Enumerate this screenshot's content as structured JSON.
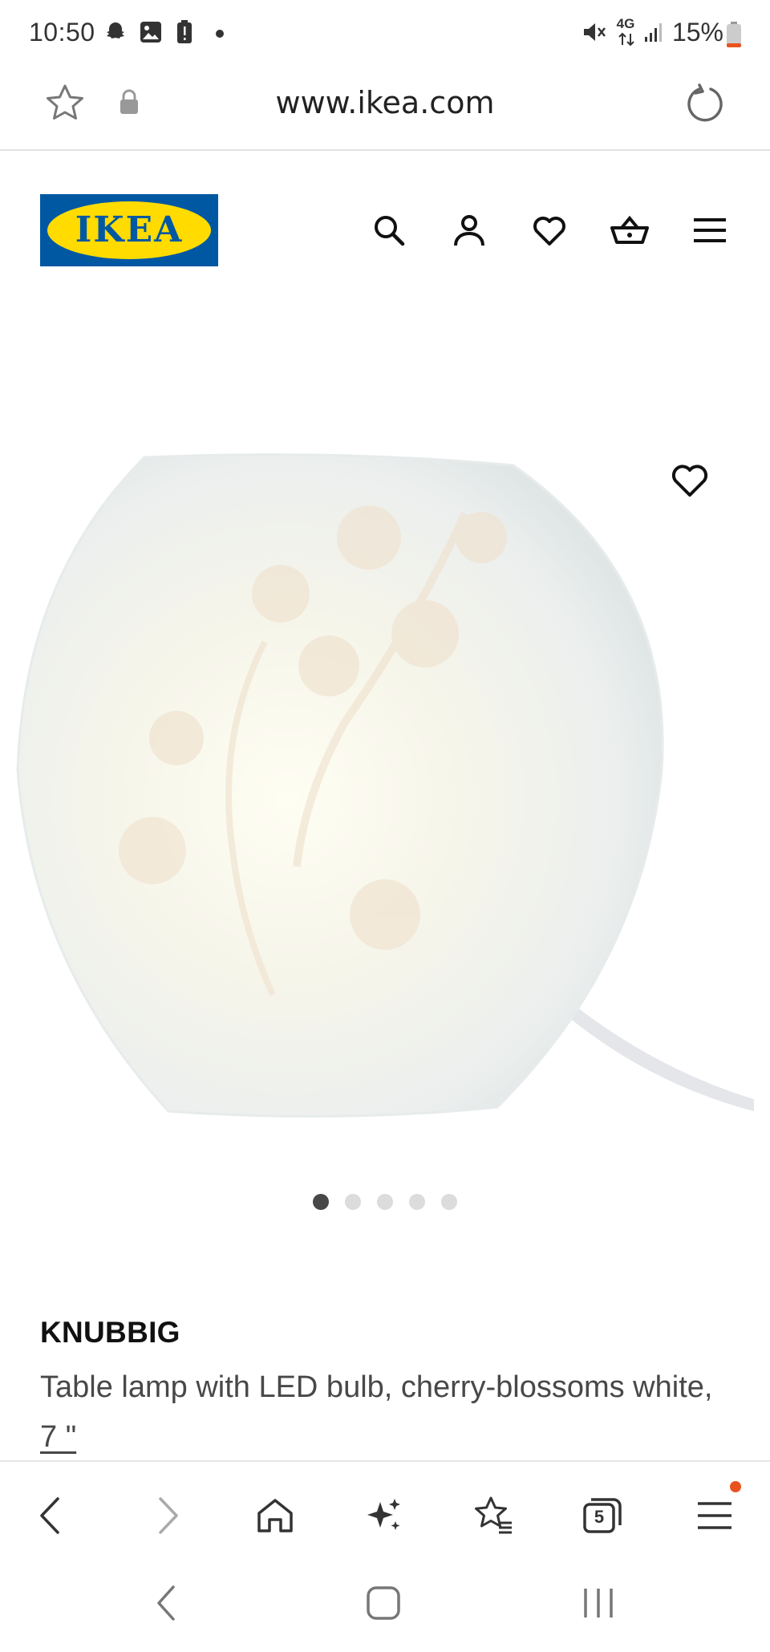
{
  "status_bar": {
    "time": "10:50",
    "network": "4G",
    "battery": "15%",
    "icons": [
      "snapchat-icon",
      "gallery-icon",
      "battery-alert-icon",
      "dot-icon",
      "mute-icon",
      "signal-icon",
      "battery-icon"
    ]
  },
  "browser": {
    "url": "www.ikea.com",
    "tab_count": "5",
    "toolbar_icons": [
      "back-icon",
      "forward-icon",
      "home-icon",
      "sparkle-icon",
      "bookmarks-icon",
      "tabs-icon",
      "menu-icon"
    ],
    "notification_color": "#e8531f"
  },
  "site_header": {
    "logo_text": "IKEA",
    "brand_blue": "#0058a3",
    "brand_yellow": "#ffdb00",
    "icons": [
      "search-icon",
      "account-icon",
      "favourites-icon",
      "basket-icon",
      "hamburger-menu-icon"
    ]
  },
  "product": {
    "name": "KNUBBIG",
    "description_prefix": "Table lamp with LED bulb, cherry-blossoms white, ",
    "size": "7 \"",
    "image_count": 5,
    "active_image": 1
  }
}
